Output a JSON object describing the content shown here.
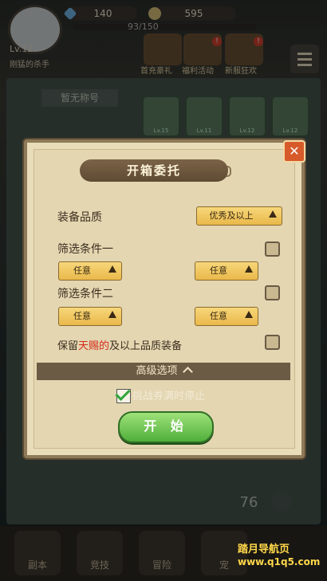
{
  "player": {
    "level": "Lv.12",
    "name": "刚猛的杀手"
  },
  "resources": {
    "gems": "140",
    "coins": "595",
    "xp": "93/150"
  },
  "events": [
    {
      "label": "首充豪礼",
      "badge": ""
    },
    {
      "label": "福利活动",
      "badge": "!"
    },
    {
      "label": "新服狂欢",
      "badge": "!"
    }
  ],
  "background": {
    "no_title": "暂无称号",
    "slots": [
      "Lv.15",
      "Lv.11",
      "Lv.12",
      "Lv.12"
    ],
    "count": "76"
  },
  "bottom_nav": [
    "副本",
    "竞技",
    "冒险",
    "宠"
  ],
  "dialog": {
    "title": "开箱委托",
    "quality_label": "装备品质",
    "quality_value": "优秀及以上",
    "filter1_label": "筛选条件一",
    "filter2_label": "筛选条件二",
    "any": "任意",
    "keep_prefix": "保留",
    "keep_highlight": "天赐的",
    "keep_suffix": "及以上品质装备",
    "advanced": "高级选项",
    "stop_label": "挑战券满时停止",
    "start": "开 始"
  },
  "watermark": {
    "line1": "踏月导航页",
    "line2": "www.q1q5.com"
  },
  "colors": {
    "highlight": "#d42d1c",
    "start_button": "#4fae3a",
    "dialog_bg": "#e9dcb9"
  }
}
